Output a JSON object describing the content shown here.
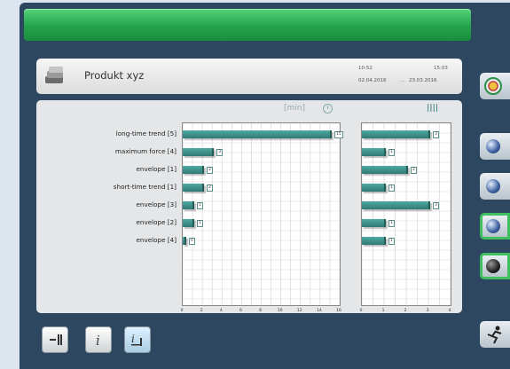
{
  "header": {
    "product_title": "Produkt xyz",
    "time_start": "10:52",
    "time_end": "15:03",
    "date_start": "02.04.2016",
    "date_sep": "...",
    "date_end": "23.03.2016"
  },
  "chart_header": {
    "unit_label": "[min]"
  },
  "chart_data": [
    {
      "type": "bar",
      "orientation": "horizontal",
      "categories": [
        "long-time trend [5]",
        "maximum force [4]",
        "envelope [1]",
        "short-time trend [1]",
        "envelope [3]",
        "envelope [2]",
        "envelope [4]"
      ],
      "values": [
        15,
        3,
        2,
        2,
        1,
        1,
        0
      ],
      "value_labels": [
        "15",
        "3",
        "2",
        "2",
        "1",
        "1",
        "0"
      ],
      "xlabel": "[min]",
      "xlim": [
        0,
        16
      ],
      "xticks": [
        "0",
        "2",
        "4",
        "6",
        "8",
        "10",
        "12",
        "14",
        "16"
      ],
      "grid": true
    },
    {
      "type": "bar",
      "orientation": "horizontal",
      "categories": [
        "long-time trend [5]",
        "maximum force [4]",
        "envelope [1]",
        "short-time trend [1]",
        "envelope [3]",
        "envelope [2]",
        "envelope [4]"
      ],
      "values": [
        3,
        1,
        2,
        1,
        3,
        1,
        1
      ],
      "value_labels": [
        "3",
        "1",
        "2",
        "1",
        "3",
        "1",
        "1"
      ],
      "xlim": [
        0,
        4
      ],
      "xticks": [
        "0",
        "1",
        "2",
        "3",
        "4"
      ],
      "grid": true
    }
  ],
  "colors": {
    "bar": "#3f8f88",
    "topbar": "#22a349",
    "frame": "#2e4761"
  },
  "icons": [
    "product-icon",
    "clock-icon",
    "count-icon",
    "minus-bar-icon",
    "info-icon",
    "list-info-icon",
    "target-icon",
    "globe-icon",
    "run-icon"
  ]
}
